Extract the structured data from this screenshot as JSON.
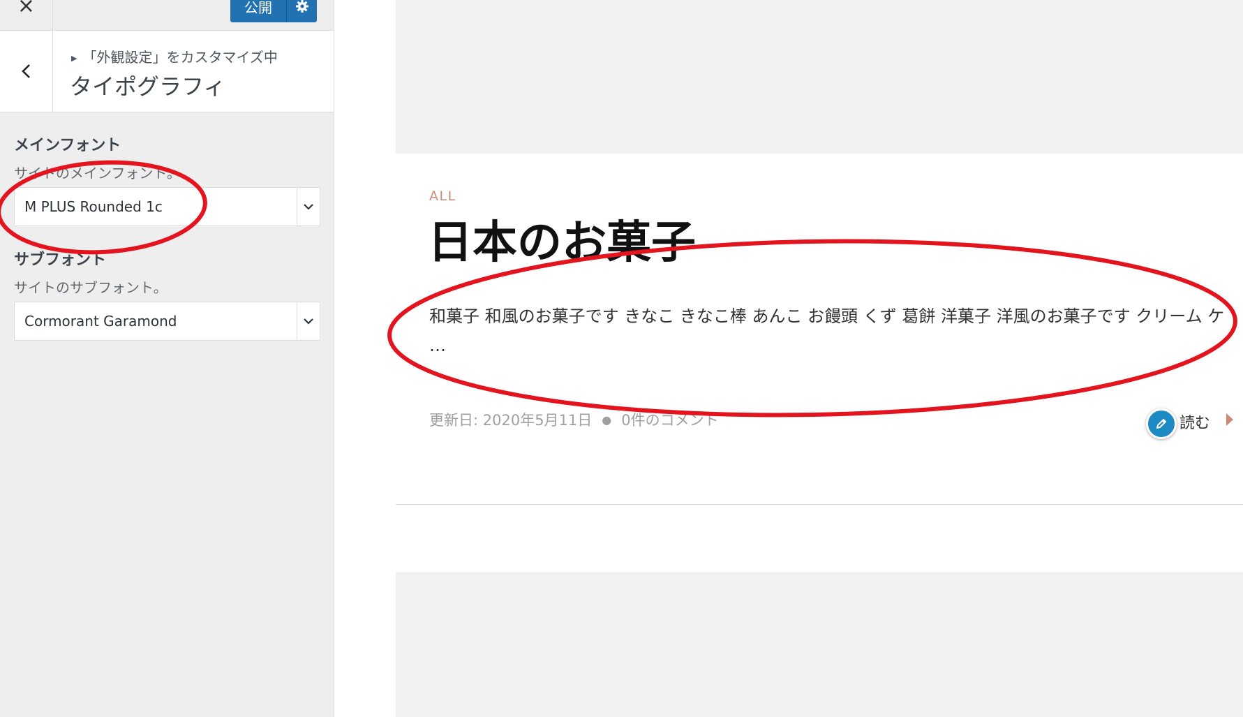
{
  "topbar": {
    "close_glyph": "×",
    "publish_label": "公開",
    "accent": "#2271b1"
  },
  "header": {
    "breadcrumb": "「外観設定」をカスタマイズ中",
    "title": "タイポグラフィ"
  },
  "controls": {
    "main_font": {
      "label": "メインフォント",
      "description": "サイトのメインフォント。",
      "selected": "M PLUS Rounded 1c"
    },
    "sub_font": {
      "label": "サブフォント",
      "description": "サイトのサブフォント。",
      "selected": "Cormorant Garamond"
    }
  },
  "preview": {
    "category": "ALL",
    "title": "日本のお菓子",
    "excerpt": "和菓子 和風のお菓子です きなこ きなこ棒 あんこ お饅頭 くず 葛餅 洋菓子 洋風のお菓子です クリーム ケ …",
    "updated": "更新日: 2020年5月11日",
    "comments": "0件のコメント",
    "read_more": "読む",
    "category_color": "#cd8a72",
    "edit_button_color": "#1d8ac4"
  },
  "icons": {
    "close": "close-icon",
    "gear": "gear-icon",
    "back": "chevron-left-icon",
    "dropdown": "chevron-down-icon",
    "edit": "pencil-icon",
    "read_more_arrow": "triangle-right-icon"
  },
  "annotation_color": "#e3141d"
}
